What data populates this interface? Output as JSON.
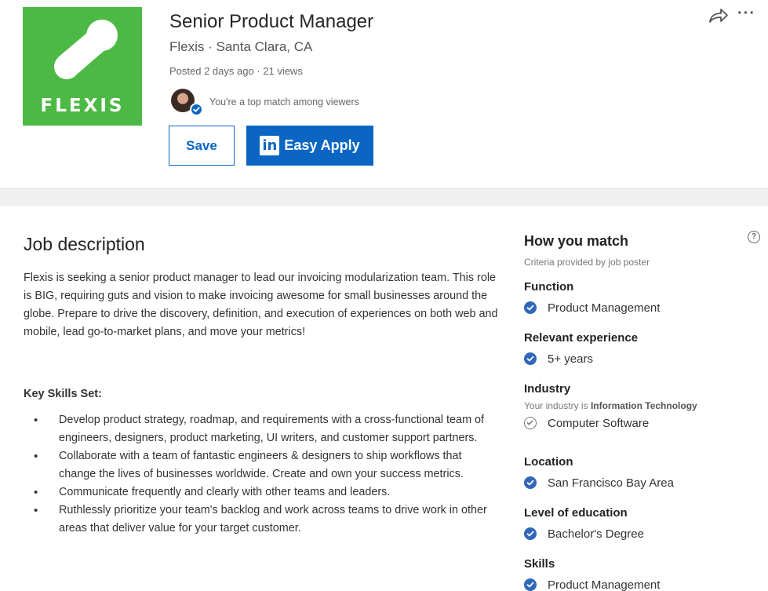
{
  "job": {
    "logo_text": "FLEXIS",
    "title": "Senior Product Manager",
    "company_location": "Flexis · Santa Clara, CA",
    "posted": "Posted 2 days ago · 21 views",
    "match_note": "You're a top match among viewers",
    "save_label": "Save",
    "apply_label": "Easy Apply",
    "apply_logo": "in",
    "more_label": "···"
  },
  "description": {
    "heading": "Job description",
    "paragraph": "Flexis is seeking a senior product manager to lead our invoicing modularization team. This role is BIG, requiring guts and vision to make invoicing awesome for small businesses around the globe. Prepare to drive the discovery, definition, and execution of experiences on both web and mobile, lead go-to-market plans, and move your metrics!",
    "skills_heading": "Key Skills Set:",
    "skills": [
      "Develop product strategy, roadmap, and requirements with a cross-functional team of engineers, designers, product marketing, UI writers, and customer support partners.",
      "Collaborate with a team of fantastic engineers & designers to ship workflows that change the lives of businesses worldwide. Create and own your success metrics.",
      "Communicate frequently and clearly with other teams and leaders.",
      "Ruthlessly prioritize your team's backlog and work across teams to drive work in other areas that deliver value for your target customer."
    ]
  },
  "match": {
    "heading": "How you match",
    "subheading": "Criteria provided by job poster",
    "help_icon": "?",
    "criteria": [
      {
        "label": "Function",
        "value": "Product Management",
        "status": "match"
      },
      {
        "label": "Relevant experience",
        "value": "5+ years",
        "status": "match"
      },
      {
        "label": "Industry",
        "note_prefix": "Your industry is ",
        "note_value": "Information Technology",
        "value": "Computer Software",
        "status": "partial"
      },
      {
        "label": "Location",
        "value": "San Francisco Bay Area",
        "status": "match"
      },
      {
        "label": "Level of education",
        "value": "Bachelor's Degree",
        "status": "match"
      },
      {
        "label": "Skills",
        "value": "Product Management",
        "status": "match"
      }
    ]
  },
  "icons": {
    "share": "share-icon",
    "more": "more-icon",
    "check": "check-circle-icon",
    "help": "help-icon"
  },
  "colors": {
    "brand_green": "#4cb944",
    "linkedin_blue": "#0a66c2",
    "check_blue": "#3067b8"
  }
}
